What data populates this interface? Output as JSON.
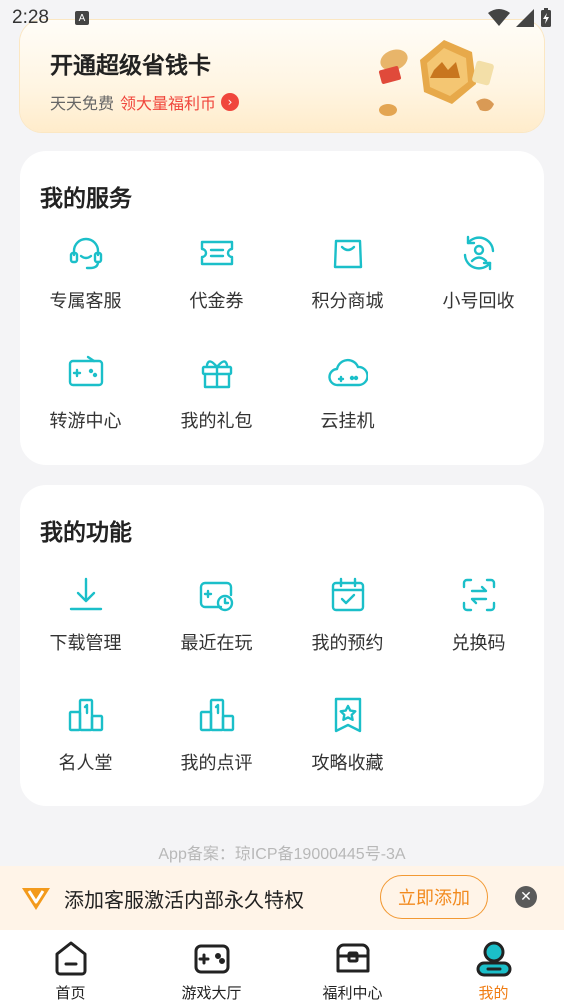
{
  "status": {
    "time": "2:28",
    "a_icon": "A"
  },
  "promo": {
    "title": "开通超级省钱卡",
    "subtitle": "天天免费",
    "highlight": "领大量福利币",
    "arrow": "›"
  },
  "services": {
    "title": "我的服务",
    "items": [
      {
        "label": "专属客服",
        "icon": "headset-icon"
      },
      {
        "label": "代金券",
        "icon": "coupon-icon"
      },
      {
        "label": "积分商城",
        "icon": "shopping-bag-icon"
      },
      {
        "label": "小号回收",
        "icon": "recycle-user-icon"
      },
      {
        "label": "转游中心",
        "icon": "game-transfer-icon"
      },
      {
        "label": "我的礼包",
        "icon": "gift-icon"
      },
      {
        "label": "云挂机",
        "icon": "cloud-gamepad-icon"
      }
    ]
  },
  "functions": {
    "title": "我的功能",
    "items": [
      {
        "label": "下载管理",
        "icon": "download-icon"
      },
      {
        "label": "最近在玩",
        "icon": "recent-play-icon"
      },
      {
        "label": "我的预约",
        "icon": "calendar-check-icon"
      },
      {
        "label": "兑换码",
        "icon": "exchange-code-icon"
      },
      {
        "label": "名人堂",
        "icon": "podium-icon"
      },
      {
        "label": "我的点评",
        "icon": "review-podium-icon"
      },
      {
        "label": "攻略收藏",
        "icon": "bookmark-star-icon"
      }
    ]
  },
  "record": "App备案：琼ICP备19000445号-3A",
  "notice": {
    "text": "添加客服激活内部永久特权",
    "button": "立即添加",
    "close": "✕"
  },
  "tabs": [
    {
      "label": "首页",
      "icon": "home-icon",
      "active": false
    },
    {
      "label": "游戏大厅",
      "icon": "gamepad-icon",
      "active": false
    },
    {
      "label": "福利中心",
      "icon": "treasure-chest-icon",
      "active": false
    },
    {
      "label": "我的",
      "icon": "profile-icon",
      "active": true
    }
  ],
  "colors": {
    "accent": "#1bbfc9",
    "orange": "#f07c12",
    "red": "#f0463c",
    "background": "#f4f4f6"
  }
}
